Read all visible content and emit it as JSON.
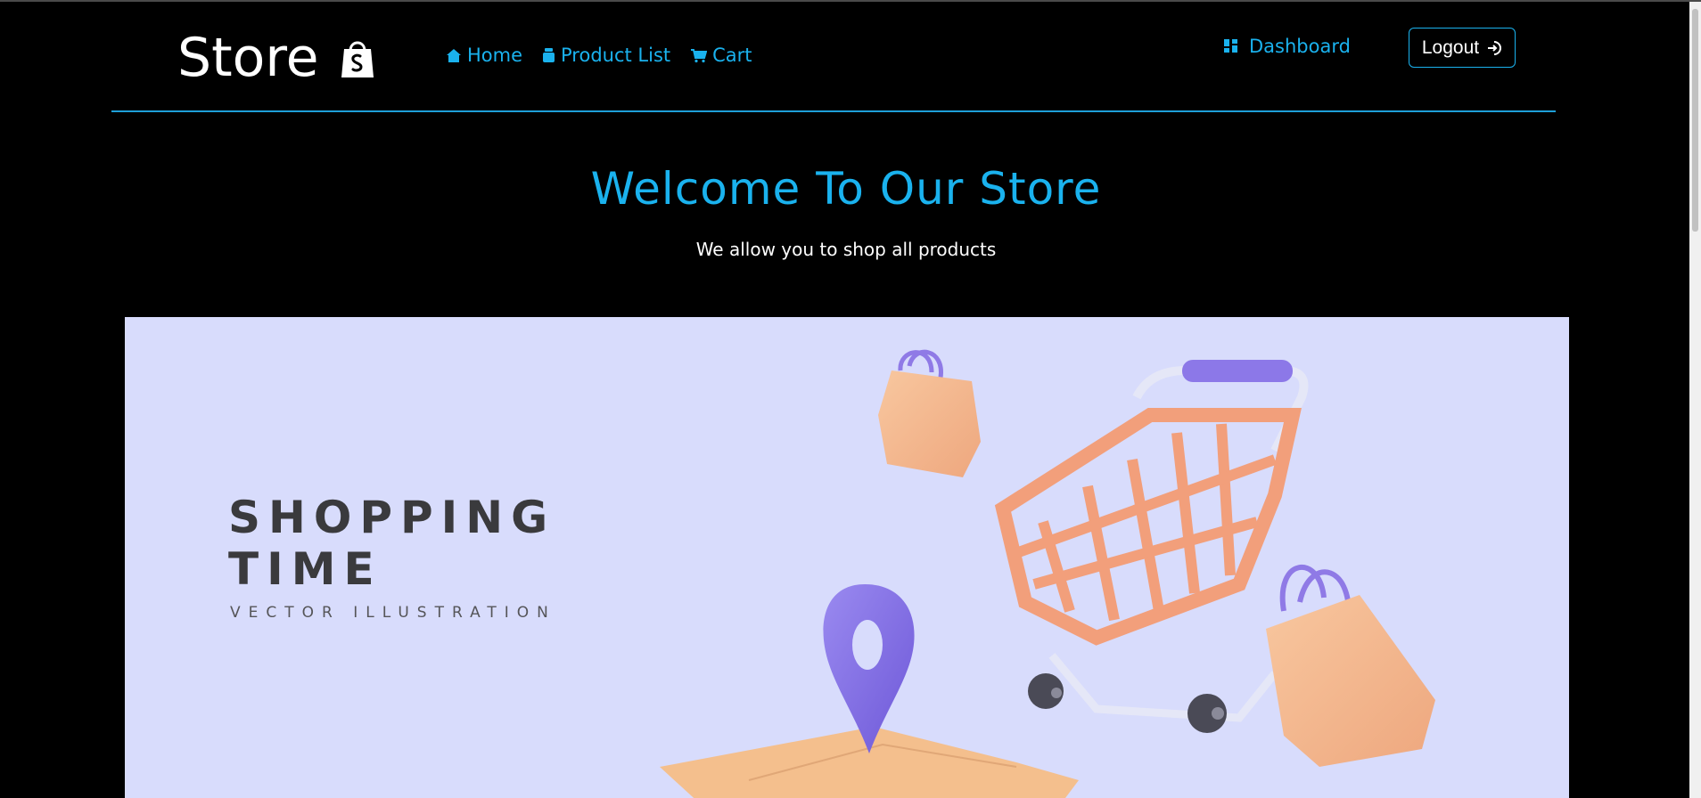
{
  "navbar": {
    "brand": "Store",
    "brand_icon": "shopping-bag-icon",
    "links": [
      {
        "label": "Home",
        "icon": "home-icon"
      },
      {
        "label": "Product List",
        "icon": "product-icon"
      },
      {
        "label": "Cart",
        "icon": "cart-icon"
      }
    ],
    "dashboard": {
      "label": "Dashboard",
      "icon": "grid-icon"
    },
    "logout": {
      "label": "Logout",
      "icon": "logout-icon"
    }
  },
  "hero": {
    "title": "Welcome To Our Store",
    "subtitle": "We allow you to shop all products"
  },
  "banner": {
    "line1": "SHOPPING",
    "line2": "TIME",
    "tagline": "VECTOR ILLUSTRATION"
  },
  "colors": {
    "background": "#000000",
    "accent": "#1ab2ee",
    "banner_bg": "#d8dcfc",
    "cart_orange": "#f4a27e",
    "pin_purple": "#8b7ae8"
  }
}
